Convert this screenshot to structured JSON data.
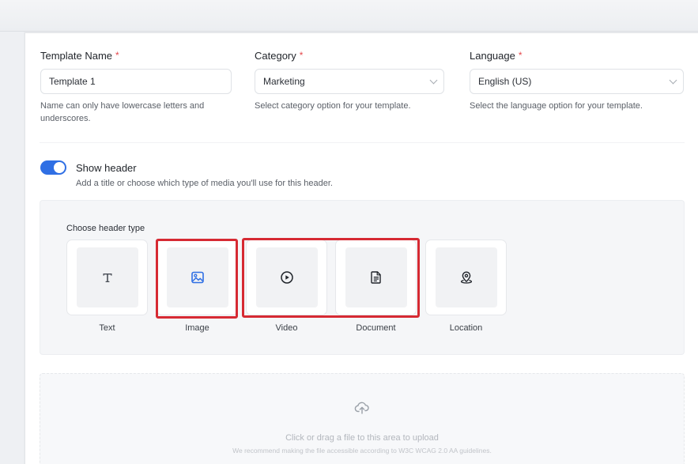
{
  "form": {
    "template_name": {
      "label": "Template Name",
      "required_mark": "*",
      "value": "Template 1",
      "help": "Name can only have lowercase letters and underscores."
    },
    "category": {
      "label": "Category",
      "required_mark": "*",
      "value": "Marketing",
      "help": "Select category option for your template."
    },
    "language": {
      "label": "Language",
      "required_mark": "*",
      "value": "English (US)",
      "help": "Select the language option for your template."
    }
  },
  "header_toggle": {
    "label": "Show header",
    "help": "Add a title or choose which type of media you'll use for this header.",
    "enabled": true
  },
  "header_types": {
    "title": "Choose header type",
    "options": [
      {
        "label": "Text",
        "icon": "text-icon"
      },
      {
        "label": "Image",
        "icon": "image-icon"
      },
      {
        "label": "Video",
        "icon": "play-icon"
      },
      {
        "label": "Document",
        "icon": "document-icon"
      },
      {
        "label": "Location",
        "icon": "location-pin-icon"
      }
    ]
  },
  "upload": {
    "icon": "upload-cloud-icon",
    "text": "Click or drag a file to this area to upload",
    "subtext": "We recommend making the file accessible according to W3C WCAG 2.0 AA guidelines."
  },
  "colors": {
    "accent": "#2f6fe4",
    "required": "#e5484d",
    "highlight": "#d62a33"
  }
}
